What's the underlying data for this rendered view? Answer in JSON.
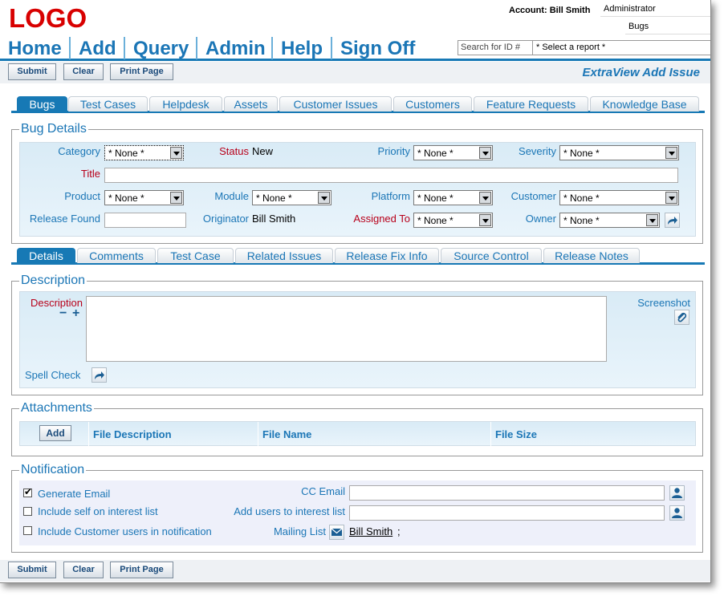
{
  "header": {
    "logo": "LOGO",
    "account": "Account: Bill Smith",
    "role": "Administrator",
    "project": "Bugs",
    "search_placeholder": "Search for ID #",
    "report_select": "* Select a report *"
  },
  "nav": [
    "Home",
    "Add",
    "Query",
    "Admin",
    "Help",
    "Sign Off"
  ],
  "buttons": {
    "submit": "Submit",
    "clear": "Clear",
    "print": "Print Page"
  },
  "page_title": "ExtraView Add Issue",
  "area_tabs": [
    "Bugs",
    "Test Cases",
    "Helpdesk",
    "Assets",
    "Customer Issues",
    "Customers",
    "Feature Requests",
    "Knowledge Base"
  ],
  "bug_details": {
    "legend": "Bug Details",
    "category_label": "Category",
    "category_value": "* None *",
    "status_label": "Status",
    "status_value": "New",
    "priority_label": "Priority",
    "priority_value": "* None *",
    "severity_label": "Severity",
    "severity_value": "* None *",
    "title_label": "Title",
    "product_label": "Product",
    "product_value": "* None *",
    "module_label": "Module",
    "module_value": "* None *",
    "platform_label": "Platform",
    "platform_value": "* None *",
    "customer_label": "Customer",
    "customer_value": "* None *",
    "release_found_label": "Release Found",
    "originator_label": "Originator",
    "originator_value": "Bill Smith",
    "assigned_label": "Assigned To",
    "assigned_value": "* None *",
    "owner_label": "Owner",
    "owner_value": "* None *"
  },
  "detail_tabs": [
    "Details",
    "Comments",
    "Test Case",
    "Related Issues",
    "Release Fix Info",
    "Source Control",
    "Release Notes"
  ],
  "description": {
    "legend": "Description",
    "label": "Description",
    "minus": "−",
    "plus": "+",
    "screenshot": "Screenshot",
    "spell_check": "Spell Check"
  },
  "attachments": {
    "legend": "Attachments",
    "add": "Add",
    "columns": [
      "File Description",
      "File Name",
      "File Size"
    ]
  },
  "notification": {
    "legend": "Notification",
    "generate_email": "Generate Email",
    "generate_email_checked": true,
    "include_self": "Include self on interest list",
    "include_self_checked": false,
    "include_customer": "Include Customer users in notification",
    "include_customer_checked": false,
    "cc_email": "CC Email",
    "add_users": "Add users to interest list",
    "mailing_list": "Mailing List",
    "mailing_user": "Bill Smith",
    "mailing_sep": ";"
  },
  "colors": {
    "accent": "#1b76b6",
    "logo": "#d80000",
    "required": "#b8001a"
  }
}
